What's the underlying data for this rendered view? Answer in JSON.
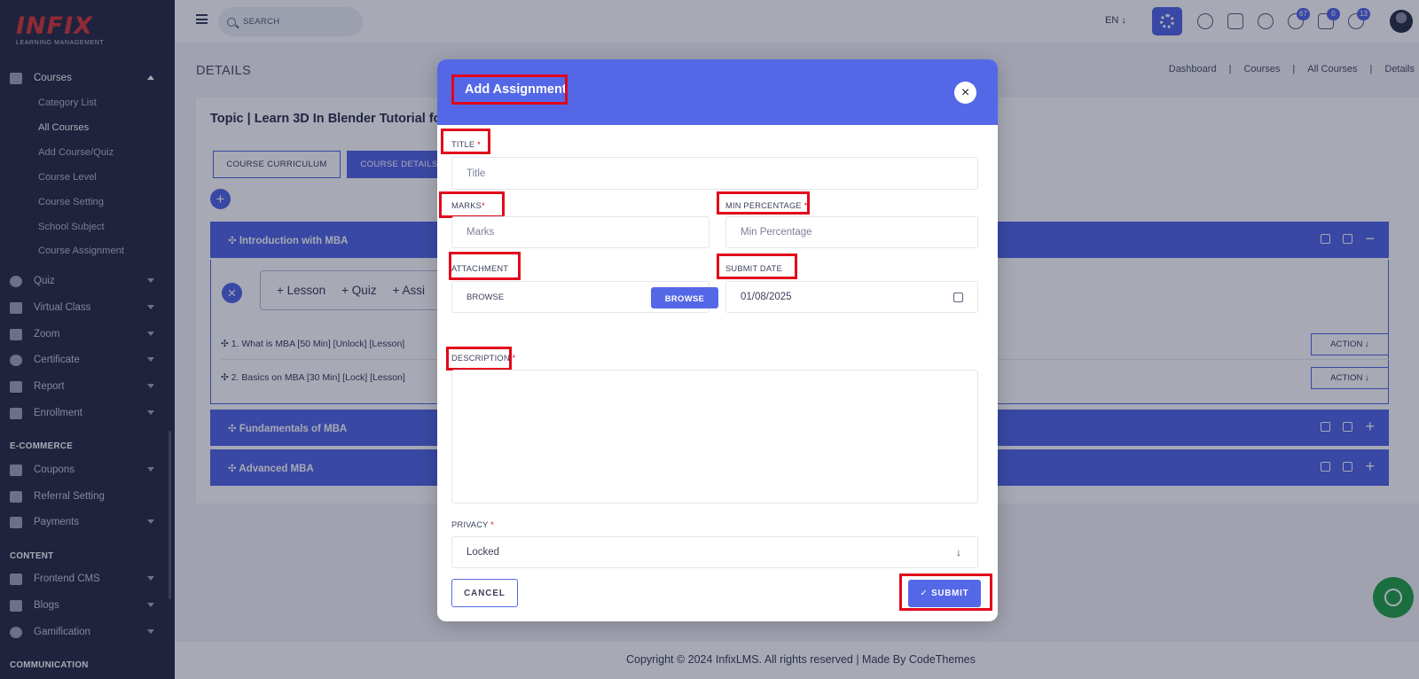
{
  "logo": {
    "brand": "INFIX",
    "subtitle": "LEARNING MANAGEMENT"
  },
  "sidebar": {
    "items": [
      {
        "label": "Courses",
        "icon": "book-icon"
      },
      {
        "label": "Quiz",
        "icon": "help-circle-icon"
      },
      {
        "label": "Virtual Class",
        "icon": "vr-icon"
      },
      {
        "label": "Zoom",
        "icon": "grid-icon"
      },
      {
        "label": "Certificate",
        "icon": "gear-icon"
      },
      {
        "label": "Report",
        "icon": "chart-icon"
      },
      {
        "label": "Enrollment",
        "icon": "enroll-icon"
      },
      {
        "label": "Coupons",
        "icon": "coupon-icon"
      },
      {
        "label": "Referral Setting",
        "icon": "users-icon"
      },
      {
        "label": "Payments",
        "icon": "money-icon"
      },
      {
        "label": "Frontend CMS",
        "icon": "brush-icon"
      },
      {
        "label": "Blogs",
        "icon": "edit-icon"
      },
      {
        "label": "Gamification",
        "icon": "medal-icon"
      }
    ],
    "course_sub": [
      "Category List",
      "All Courses",
      "Add Course/Quiz",
      "Course Level",
      "Course Setting",
      "School Subject",
      "Course Assignment"
    ],
    "sections": {
      "ecommerce": "E-COMMERCE",
      "content": "CONTENT",
      "communication": "COMMUNICATION"
    }
  },
  "topbar": {
    "search_placeholder": "SEARCH",
    "lang": "EN ↓",
    "badges": {
      "notifications": "67",
      "messages": "0",
      "whatsapp": "13"
    }
  },
  "page": {
    "title": "DETAILS",
    "breadcrumb": [
      "Dashboard",
      "Courses",
      "All Courses",
      "Details"
    ],
    "topic": "Topic | Learn 3D In Blender Tutorial fo",
    "tabs": [
      "COURSE CURRICULUM",
      "COURSE DETAILS"
    ],
    "sections": [
      "✣ Introduction with MBA",
      "✣ Fundamentals of MBA",
      "✣ Advanced MBA"
    ],
    "add_links": [
      "+ Lesson",
      "+ Quiz",
      "+ Assi"
    ],
    "lessons": [
      {
        "title": "✣ 1. What is MBA [50 Min] [Unlock] [Lesson]",
        "action": "ACTION ↓"
      },
      {
        "title": "✣ 2. Basics on MBA [30 Min] [Lock] [Lesson]",
        "action": "ACTION ↓"
      }
    ],
    "footer": "Copyright © 2024 InfixLMS. All rights reserved | Made By CodeThemes"
  },
  "modal": {
    "title": "Add Assignment",
    "close": "×",
    "fields": {
      "title_label": "TITLE",
      "title_placeholder": "Title",
      "marks_label": "MARKS",
      "marks_placeholder": "Marks",
      "min_label": "MIN PERCENTAGE",
      "min_placeholder": "Min Percentage",
      "attachment_label": "ATTACHMENT",
      "attachment_value": "BROWSE",
      "browse_button": "BROWSE",
      "submit_date_label": "SUBMIT DATE",
      "submit_date_value": "01/08/2025",
      "description_label": "DESCRIPTION",
      "privacy_label": "PRIVACY",
      "privacy_value": "Locked",
      "required_mark": "*"
    },
    "cancel": "CANCEL",
    "submit": "✓ SUBMIT"
  },
  "colors": {
    "primary": "#5468e7",
    "sidebar": "#2b2e45",
    "highlight": "#e2061b",
    "whatsapp": "#25a549"
  }
}
